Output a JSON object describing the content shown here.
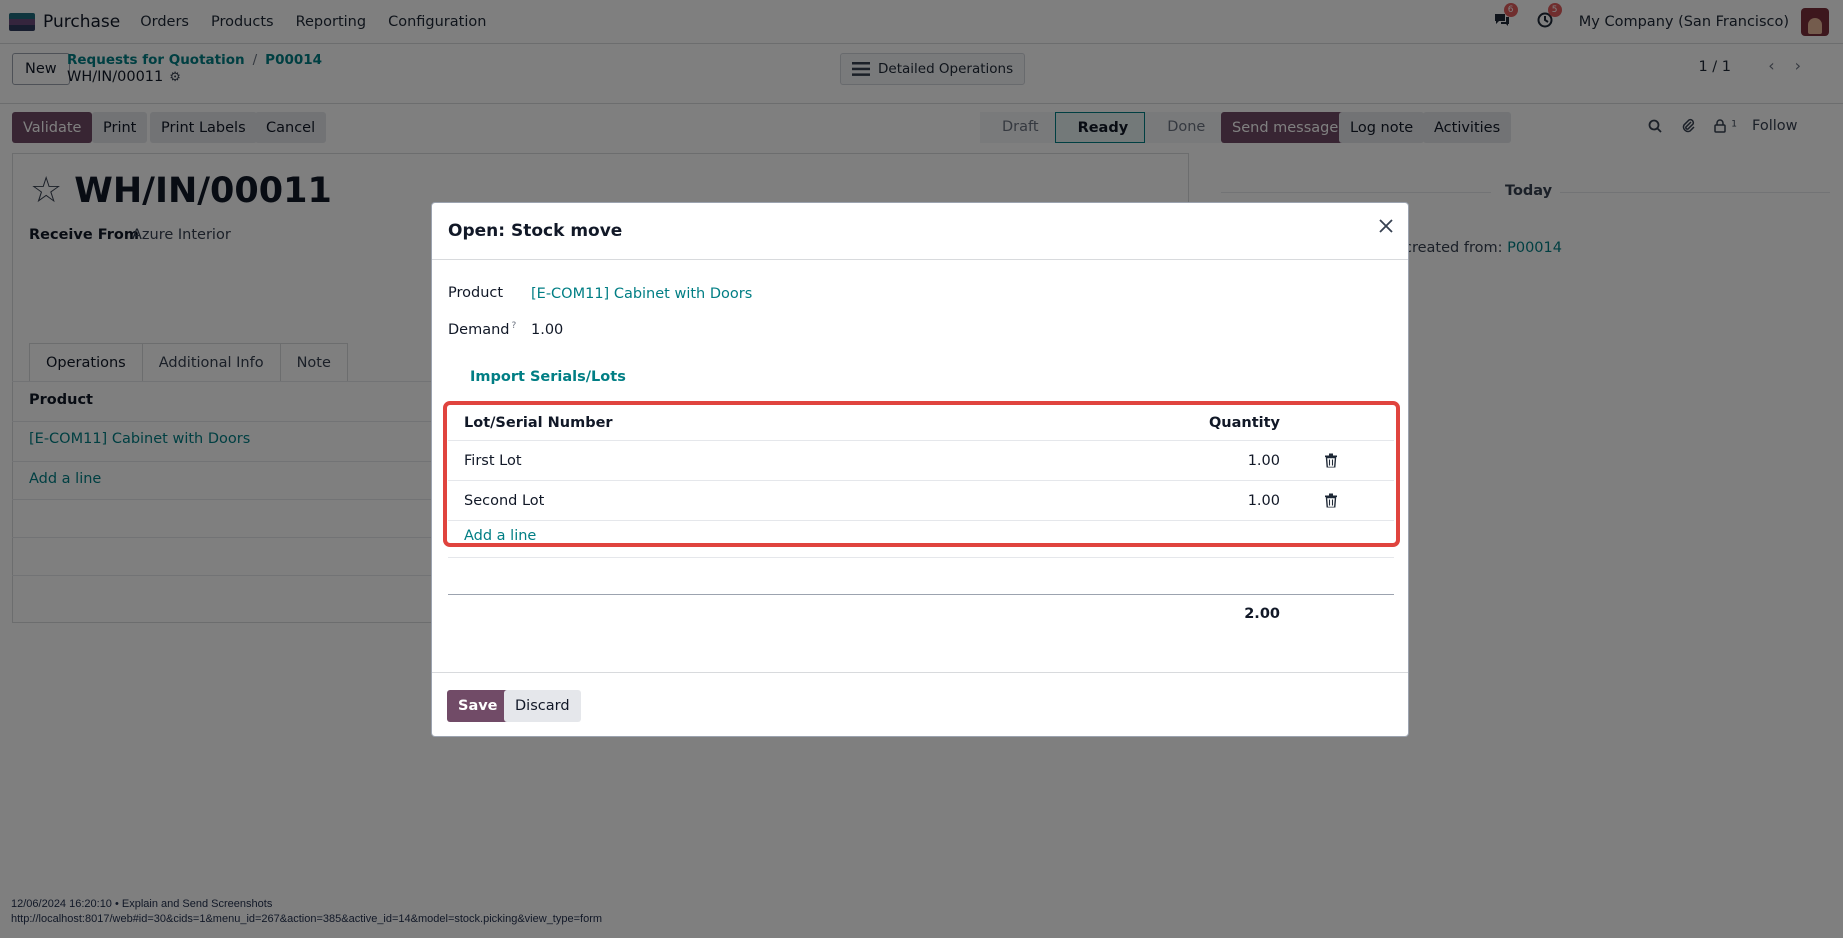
{
  "navbar": {
    "app_name": "Purchase",
    "menu": [
      "Orders",
      "Products",
      "Reporting",
      "Configuration"
    ],
    "messages_badge": "6",
    "activities_badge": "5",
    "company": "My Company (San Francisco)"
  },
  "control": {
    "new_label": "New",
    "breadcrumb_1": "Requests for Quotation",
    "breadcrumb_sep": "/",
    "breadcrumb_2": "P00014",
    "record_name": "WH/IN/00011",
    "detailed_operations": "Detailed Operations",
    "pager": "1 / 1"
  },
  "actions": {
    "validate": "Validate",
    "print": "Print",
    "print_labels": "Print Labels",
    "cancel": "Cancel"
  },
  "status": {
    "stages": [
      "Draft",
      "Ready",
      "Done"
    ],
    "active": "Ready"
  },
  "form": {
    "title": "WH/IN/00011",
    "receive_from_label": "Receive From",
    "receive_from_value": "Azure Interior",
    "tabs": [
      "Operations",
      "Additional Info",
      "Note"
    ],
    "product_header": "Product",
    "product_row": "[E-COM11] Cabinet with Doors",
    "add_line": "Add a line"
  },
  "chatter": {
    "send_message": "Send message",
    "log_note": "Log note",
    "activities": "Activities",
    "followers_count": "1",
    "follow": "Follow",
    "today": "Today",
    "created_from_text": "created from:",
    "created_from_link": "P00014"
  },
  "footer": {
    "line1": "12/06/2024 16:20:10 • Explain and Send Screenshots",
    "line2": "http://localhost:8017/web#id=30&cids=1&menu_id=267&action=385&active_id=14&model=stock.picking&view_type=form"
  },
  "modal": {
    "title": "Open: Stock move",
    "product_label": "Product",
    "product_value": "[E-COM11] Cabinet with Doors",
    "demand_label": "Demand",
    "demand_help": "?",
    "demand_value": "1.00",
    "import_link": "Import Serials/Lots",
    "table_headers": {
      "lot": "Lot/Serial Number",
      "quantity": "Quantity"
    },
    "rows": [
      {
        "lot": "First Lot",
        "quantity": "1.00"
      },
      {
        "lot": "Second Lot",
        "quantity": "1.00"
      }
    ],
    "add_line": "Add a line",
    "total": "2.00",
    "save": "Save",
    "discard": "Discard"
  },
  "colors": {
    "primary": "#714b67",
    "link": "#017e84",
    "highlight": "#e0443e"
  }
}
